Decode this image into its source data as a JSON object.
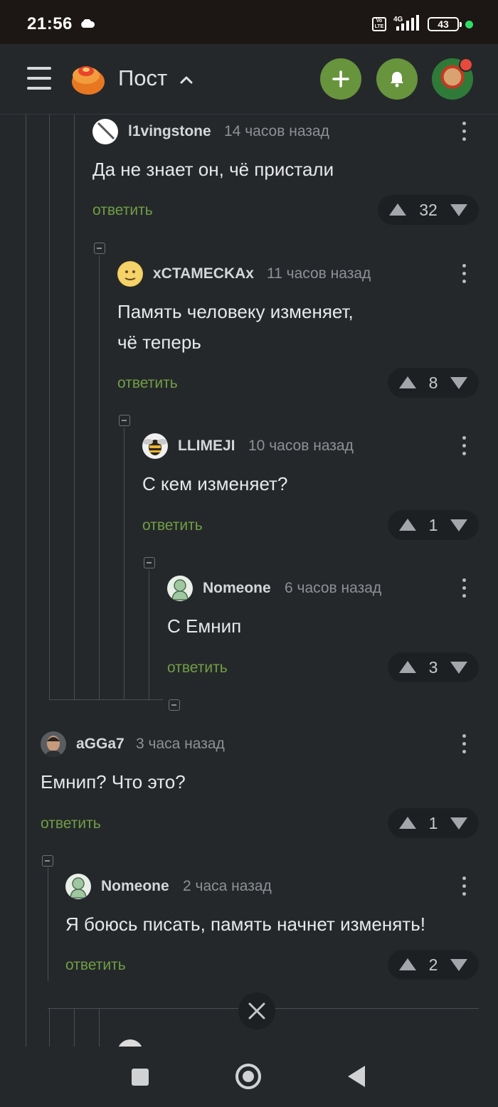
{
  "status": {
    "time": "21:56",
    "volte": "Vo LTE",
    "network": "4G",
    "battery": "43"
  },
  "header": {
    "title": "Пост",
    "plus_icon": "plus-icon",
    "bell_icon": "bell-icon"
  },
  "reply_label": "ответить",
  "comments": [
    {
      "user": "l1vingstone",
      "time": "14 часов назад",
      "text": [
        "Да не знает он, чё пристали"
      ],
      "votes": "32"
    },
    {
      "user": "xCTAMECKAx",
      "time": "11 часов назад",
      "text": [
        "Память человеку изменяет,",
        "чё теперь"
      ],
      "votes": "8"
    },
    {
      "user": "LLIMEJI",
      "time": "10 часов назад",
      "text": [
        "С кем изменяет?"
      ],
      "votes": "1"
    },
    {
      "user": "Nomeone",
      "time": "6 часов назад",
      "text": [
        "С Емнип"
      ],
      "votes": "3"
    },
    {
      "user": "aGGa7",
      "time": "3 часа назад",
      "text": [
        "Емнип? Что это?"
      ],
      "votes": "1"
    },
    {
      "user": "Nomeone",
      "time": "2 часа назад",
      "text": [
        "Я боюсь писать, память начнет изменять!"
      ],
      "votes": "2"
    }
  ],
  "colors": {
    "accent_green": "#67943d",
    "reply_green": "#6f9e44",
    "background": "#25282b"
  }
}
